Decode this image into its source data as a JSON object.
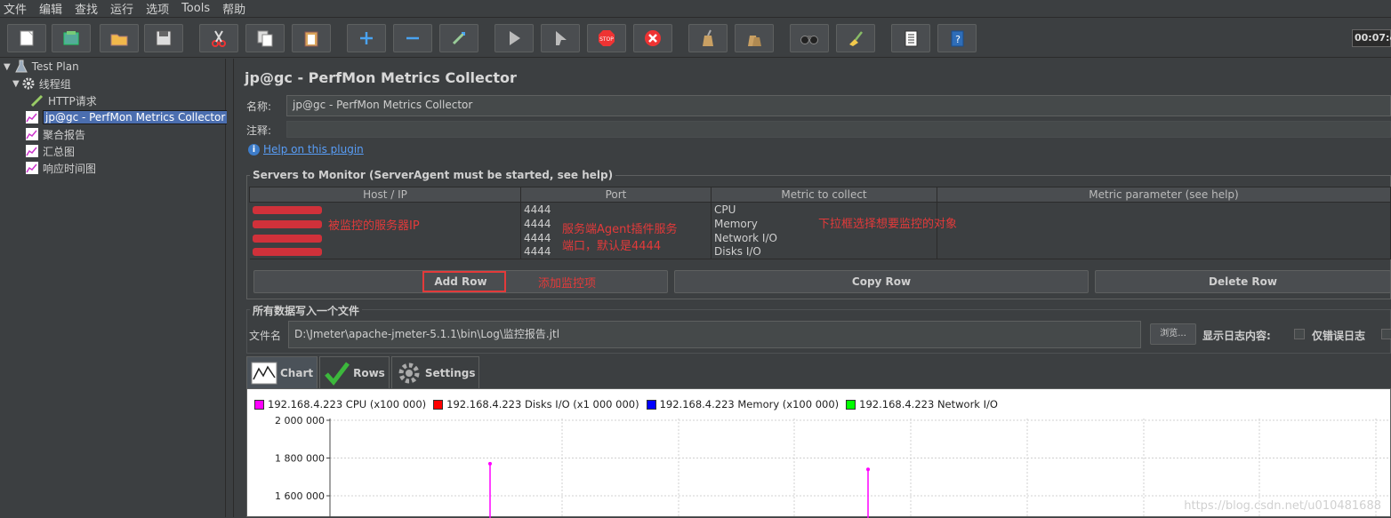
{
  "menu": [
    "文件",
    "编辑",
    "查找",
    "运行",
    "选项",
    "Tools",
    "帮助"
  ],
  "toolbar": {
    "buttons": [
      "new-icon",
      "templates-icon",
      "open-icon",
      "save-icon",
      "cut-icon",
      "copy-icon",
      "paste-icon",
      "expand-icon",
      "collapse-icon",
      "toggle-icon",
      "start-icon",
      "start-no-pause-icon",
      "stop-icon",
      "shutdown-icon",
      "clear-icon",
      "clear-all-icon",
      "search-icon",
      "reset-search-icon",
      "function-helper-icon",
      "help-icon"
    ],
    "timer": "00:07:4"
  },
  "tree": {
    "items": [
      {
        "label": "Test Plan",
        "icon": "flask-icon"
      },
      {
        "label": "线程组",
        "icon": "gear-icon"
      },
      {
        "label": "HTTP请求",
        "icon": "pipette-icon"
      },
      {
        "label": "jp@gc - PerfMon Metrics Collector",
        "icon": "chart-icon",
        "selected": true
      },
      {
        "label": "聚合报告",
        "icon": "chart-icon"
      },
      {
        "label": "汇总图",
        "icon": "chart-icon"
      },
      {
        "label": "响应时间图",
        "icon": "chart-icon"
      }
    ]
  },
  "panel": {
    "title": "jp@gc - PerfMon Metrics Collector",
    "name_label": "名称:",
    "name_value": "jp@gc - PerfMon Metrics Collector",
    "comment_label": "注释:",
    "comment_value": "",
    "help_link": "Help on this plugin"
  },
  "servers": {
    "group_title": "Servers to Monitor (ServerAgent must be started, see help)",
    "columns": [
      "Host / IP",
      "Port",
      "Metric to collect",
      "Metric parameter (see help)"
    ],
    "rows": [
      {
        "port": "4444",
        "metric": "CPU",
        "param": ""
      },
      {
        "port": "4444",
        "metric": "Memory",
        "param": ""
      },
      {
        "port": "4444",
        "metric": "Network I/O",
        "param": ""
      },
      {
        "port": "4444",
        "metric": "Disks I/O",
        "param": ""
      }
    ],
    "buttons": {
      "add": "Add Row",
      "copy": "Copy Row",
      "delete": "Delete Row"
    }
  },
  "annotations": {
    "server_ip": "被监控的服务器IP",
    "agent_port_line1": "服务端Agent插件服务",
    "agent_port_line2": "端口，默认是4444",
    "metric_select": "下拉框选择想要监控的对象",
    "add_row": "添加监控项"
  },
  "file_section": {
    "group_title": "所有数据写入一个文件",
    "file_label": "文件名",
    "file_value": "D:\\Jmeter\\apache-jmeter-5.1.1\\bin\\Log\\监控报告.jtl",
    "browse": "浏览...",
    "log_label": "显示日志内容:",
    "errors_only": "仅错误日志"
  },
  "tabs": [
    "Chart",
    "Rows",
    "Settings"
  ],
  "chart_data": {
    "type": "line",
    "series": [
      {
        "name": "192.168.4.223 CPU (x100 000)",
        "color": "#ff00ff"
      },
      {
        "name": "192.168.4.223 Disks I/O (x1 000 000)",
        "color": "#ff0000"
      },
      {
        "name": "192.168.4.223 Memory (x100 000)",
        "color": "#0000ff"
      },
      {
        "name": "192.168.4.223 Network I/O",
        "color": "#00ff00"
      }
    ],
    "y_ticks": [
      "2 000 000",
      "1 800 000",
      "1 600 000"
    ],
    "spikes": [
      {
        "series": "192.168.4.223 CPU (x100 000)",
        "y": 1770000
      },
      {
        "series": "192.168.4.223 CPU (x100 000)",
        "y": 1740000
      }
    ],
    "grid": true
  },
  "watermark": "https://blog.csdn.net/u010481688"
}
